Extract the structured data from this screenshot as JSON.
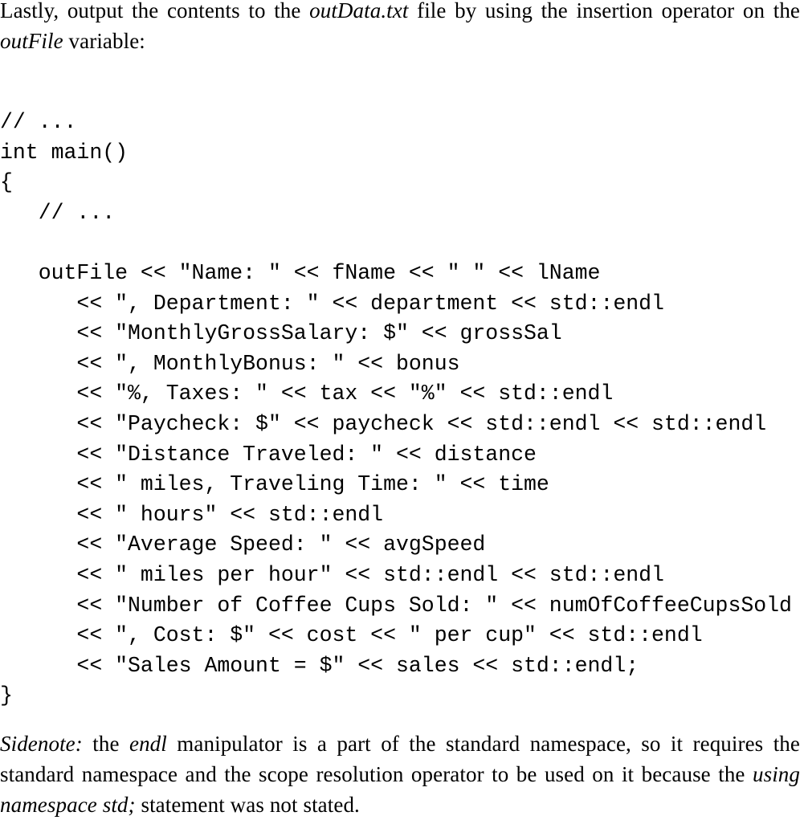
{
  "intro": {
    "before_file": "Lastly, output the contents to the ",
    "file_name": "outData.txt",
    "after_file": " file by using the insertion operator on the ",
    "variable": "outFile",
    "after_variable": " variable:"
  },
  "code": {
    "lines": [
      "// ...",
      "int main()",
      "{",
      "   // ...",
      "",
      "   outFile << \"Name: \" << fName << \" \" << lName",
      "      << \", Department: \" << department << std::endl",
      "      << \"MonthlyGrossSalary: $\" << grossSal",
      "      << \", MonthlyBonus: \" << bonus",
      "      << \"%, Taxes: \" << tax << \"%\" << std::endl",
      "      << \"Paycheck: $\" << paycheck << std::endl << std::endl",
      "      << \"Distance Traveled: \" << distance",
      "      << \" miles, Traveling Time: \" << time",
      "      << \" hours\" << std::endl",
      "      << \"Average Speed: \" << avgSpeed",
      "      << \" miles per hour\" << std::endl << std::endl",
      "      << \"Number of Coffee Cups Sold: \" << numOfCoffeeCupsSold",
      "      << \", Cost: $\" << cost << \" per cup\" << std::endl",
      "      << \"Sales Amount = $\" << sales << std::endl;",
      "}"
    ]
  },
  "sidenote": {
    "label": "Sidenote:",
    "part1": " the ",
    "term": "endl",
    "part2": " manipulator is a part of the standard namespace, so it requires the standard namespace and the scope resolution operator to be used on it because the ",
    "statement": "using namespace std;",
    "part3": " statement was not stated."
  }
}
